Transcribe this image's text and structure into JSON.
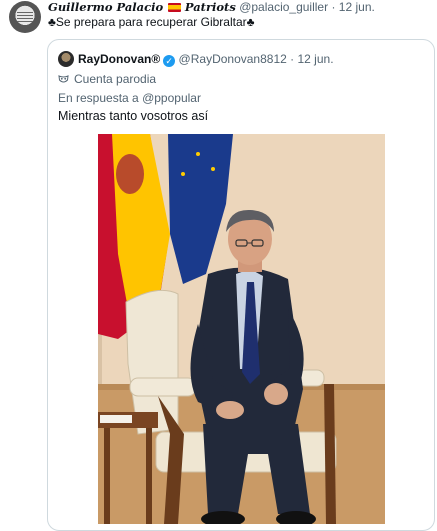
{
  "tweet": {
    "author_name": "Guillermo Palacio",
    "author_suffix": "Patriots",
    "handle": "@palacio_guiller",
    "separator": "·",
    "date": "12 jun.",
    "text_prefix": "♣",
    "text": "Se prepara para recuperar Gibraltar",
    "text_suffix": "♣"
  },
  "quote": {
    "author_name": "RayDonovan®",
    "handle": "@RayDonovan8812",
    "separator": "·",
    "date": "12 jun.",
    "parody_label": "Cuenta parodia",
    "reply_prefix": "En respuesta a",
    "reply_handle": "@ppopular",
    "text": "Mientras tanto vosotros así",
    "verified_color": "#1d9bf0"
  },
  "icons": {
    "avatar": "avatar",
    "flag": "spain-flag-icon",
    "club": "club-suit-icon",
    "verified": "verified-badge-icon",
    "parody": "mask-icon"
  }
}
